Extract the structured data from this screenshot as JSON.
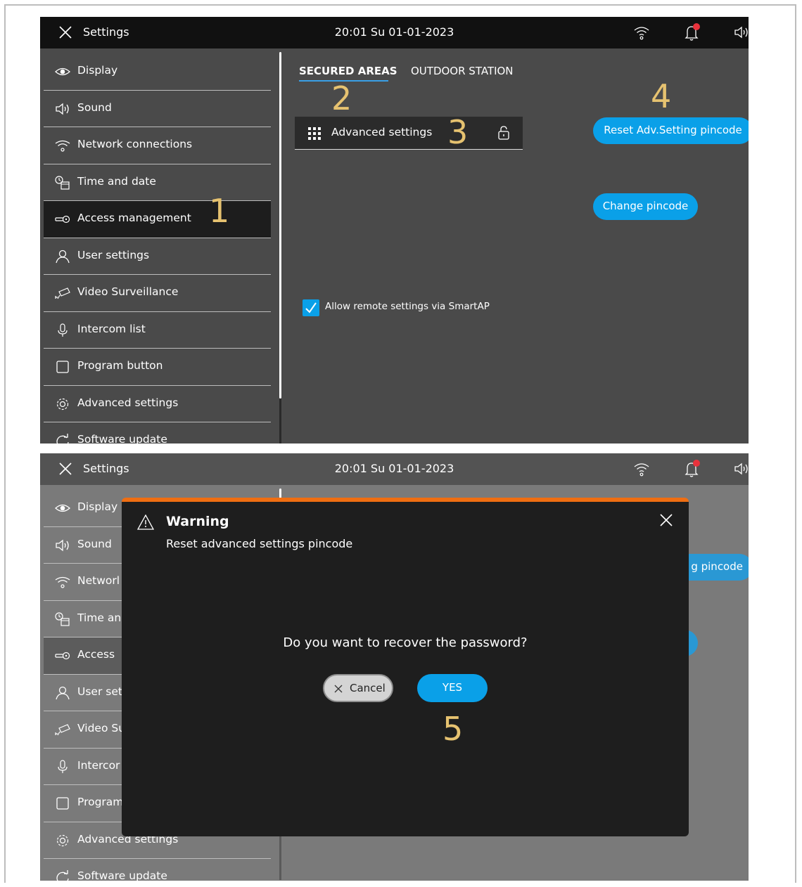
{
  "topbar": {
    "title": "Settings",
    "datetime": "20:01  Su 01-01-2023",
    "icons": [
      "close-icon",
      "wifi-icon",
      "notification-bell-icon",
      "speaker-icon"
    ],
    "notification_dot_color": "#e8323c"
  },
  "sidebar": {
    "items": [
      {
        "label": "Display",
        "icon": "eye-icon"
      },
      {
        "label": "Sound",
        "icon": "speaker-icon"
      },
      {
        "label": "Network connections",
        "icon": "wifi-icon"
      },
      {
        "label": "Time and date",
        "icon": "clock-calendar-icon"
      },
      {
        "label": "Access  management",
        "icon": "key-icon",
        "active": true
      },
      {
        "label": "User settings",
        "icon": "user-icon"
      },
      {
        "label": "Video Surveillance",
        "icon": "camera-icon"
      },
      {
        "label": "Intercom list",
        "icon": "microphone-icon"
      },
      {
        "label": "Program button",
        "icon": "square-icon"
      },
      {
        "label": "Advanced settings",
        "icon": "gear-icon"
      },
      {
        "label": "Software update",
        "icon": "refresh-icon"
      }
    ]
  },
  "screen2_sidebar": {
    "items": [
      "Display",
      "Sound",
      "Networl",
      "Time an",
      "Access",
      "User set",
      "Video Su",
      "Intercor",
      "Program",
      "Advanced settings",
      "Software update"
    ]
  },
  "tabs": [
    {
      "label": "SECURED AREAS",
      "selected": true
    },
    {
      "label": "OUTDOOR STATION",
      "selected": false
    }
  ],
  "secured_area_row": {
    "label": "Advanced settings",
    "icons": [
      "grid-icon",
      "lock-icon"
    ]
  },
  "buttons": {
    "reset_pincode": "Reset Adv.Setting pincode",
    "reset_pincode_partial": "g pincode",
    "change_pincode": "Change pincode"
  },
  "remote_checkbox": {
    "label": "Allow remote settings via SmartAP",
    "checked": true
  },
  "annotations": [
    "1",
    "2",
    "3",
    "4",
    "5"
  ],
  "dialog": {
    "title": "Warning",
    "subtitle": "Reset advanced settings pincode",
    "question": "Do you want to recover the password?",
    "cancel_label": "Cancel",
    "yes_label": "YES",
    "accent_color": "#ef6e12"
  },
  "colors": {
    "accent_blue": "#0aa0e8",
    "annotation": "#e6c270"
  }
}
